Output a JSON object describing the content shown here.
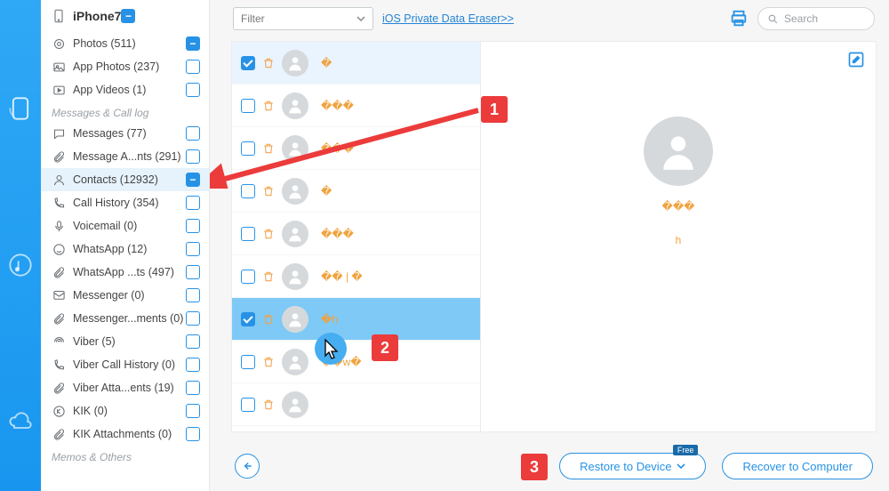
{
  "device": {
    "name": "iPhone7"
  },
  "sidebar": {
    "groups": [
      {
        "header": null,
        "items": [
          {
            "icon": "photo",
            "label": "Photos (511)",
            "checked": true
          },
          {
            "icon": "appphoto",
            "label": "App Photos (237)",
            "checked": false
          },
          {
            "icon": "video",
            "label": "App Videos (1)",
            "checked": false
          }
        ]
      },
      {
        "header": "Messages & Call log",
        "items": [
          {
            "icon": "msg",
            "label": "Messages (77)",
            "checked": false
          },
          {
            "icon": "clip",
            "label": "Message A...nts (291)",
            "checked": false
          },
          {
            "icon": "contact",
            "label": "Contacts (12932)",
            "checked": true,
            "selected": true
          },
          {
            "icon": "call",
            "label": "Call History (354)",
            "checked": false
          },
          {
            "icon": "vmail",
            "label": "Voicemail (0)",
            "checked": false
          },
          {
            "icon": "wa",
            "label": "WhatsApp (12)",
            "checked": false
          },
          {
            "icon": "clip",
            "label": "WhatsApp ...ts (497)",
            "checked": false
          },
          {
            "icon": "msgr",
            "label": "Messenger (0)",
            "checked": false
          },
          {
            "icon": "clip",
            "label": "Messenger...ments (0)",
            "checked": false
          },
          {
            "icon": "viber",
            "label": "Viber (5)",
            "checked": false
          },
          {
            "icon": "call",
            "label": "Viber Call History (0)",
            "checked": false
          },
          {
            "icon": "clip",
            "label": "Viber Atta...ents (19)",
            "checked": false
          },
          {
            "icon": "kik",
            "label": "KIK (0)",
            "checked": false
          },
          {
            "icon": "clip",
            "label": "KIK Attachments (0)",
            "checked": false
          }
        ]
      },
      {
        "header": "Memos & Others",
        "items": []
      }
    ]
  },
  "toolbar": {
    "filter_label": "Filter",
    "eraser_link": "iOS Private Data Eraser>>",
    "search_placeholder": "Search"
  },
  "contact_list": [
    {
      "name": "�",
      "checked": true,
      "selected": true
    },
    {
      "name": "���",
      "checked": false
    },
    {
      "name": "���",
      "checked": false
    },
    {
      "name": "�",
      "checked": false
    },
    {
      "name": "���",
      "checked": false
    },
    {
      "name": "�� | �",
      "checked": false
    },
    {
      "name": "�h",
      "checked": true,
      "highlight": true
    },
    {
      "name": "��w�",
      "checked": false
    },
    {
      "name": "",
      "checked": false
    }
  ],
  "detail": {
    "code": "���",
    "sub": "h"
  },
  "bottom": {
    "restore_label": "Restore to Device",
    "restore_badge": "Free",
    "recover_label": "Recover to Computer"
  },
  "annotations": {
    "one": "1",
    "two": "2",
    "three": "3"
  }
}
